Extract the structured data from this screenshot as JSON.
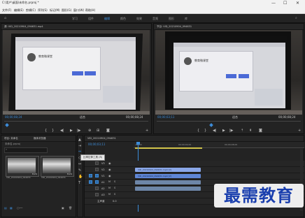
{
  "window": {
    "title": "C:\\用户\\桌面\\未命名.prproj *",
    "controls": [
      "—",
      "☐",
      "✕"
    ]
  },
  "menu": [
    "文件(F)",
    "编辑(E)",
    "剪辑(C)",
    "序列(S)",
    "标记(M)",
    "图形(G)",
    "窗口(W)",
    "帮助(H)"
  ],
  "workspace_tabs": [
    "学习",
    "组件",
    "编辑",
    "颜色",
    "效果",
    "音频",
    "图形",
    "库"
  ],
  "source_monitor": {
    "title": "源: VID_20210904_094631.mp4",
    "timecode_left": "00;00;08;24",
    "fit": "适合",
    "timecode_right": "00;00;08;24",
    "page_title": "教育微课堂"
  },
  "program_monitor": {
    "title": "节目: VID_20210904_094631",
    "timecode_left": "00;00;03;11",
    "fit": "适合",
    "timecode_right": "00;00;08;24",
    "page_title": "教育微课堂"
  },
  "project_panel": {
    "title": "项目: 未命名",
    "tab2": "媒体浏览器",
    "file": "未命名.prproj",
    "clips": [
      {
        "name": "VID_20210904_094631",
        "duration": "8;24"
      },
      {
        "name": "VID_20210904_094631",
        "duration": "8;24"
      }
    ]
  },
  "timeline": {
    "title": "VID_20210904_094631",
    "timecode": "00;00;03;11",
    "ruler": [
      ":00;00",
      "00;00;04;00",
      "00;00;08;00"
    ],
    "tooltip": "比率拉伸工具 (R)",
    "tracks": [
      "V3",
      "V2",
      "V1",
      "A1",
      "A2",
      "A3",
      "主声道"
    ],
    "master_value": "0.0",
    "clips": [
      {
        "label": "VID_20210904_094631.mp4 [V]",
        "color": "#8aa7e8"
      },
      {
        "label": "VID_20210904_094631.mp4 [V]",
        "color": "#5f86d6"
      },
      {
        "label": "",
        "color": "#6d86a8"
      },
      {
        "label": "",
        "color": "#6d86a8"
      }
    ]
  },
  "watermark": "最需教育"
}
